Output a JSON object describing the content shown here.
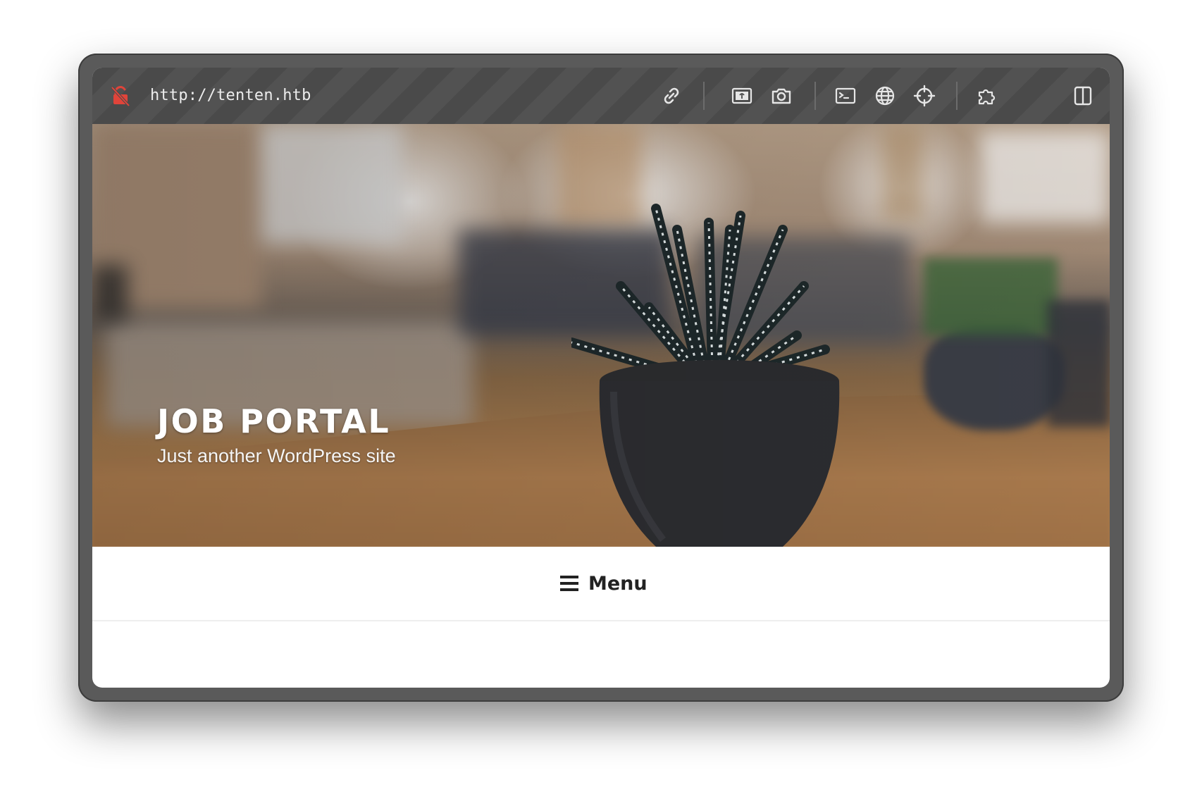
{
  "browser": {
    "url": "http://tenten.htb",
    "icons": {
      "security": "unlock-warning-icon",
      "link": "link-icon",
      "picture": "image-icon",
      "camera": "camera-icon",
      "terminal": "terminal-icon",
      "globe": "globe-icon",
      "target": "crosshair-icon",
      "extensions": "puzzle-icon",
      "split": "split-view-icon"
    },
    "colors": {
      "toolbar": "#4a4a4a",
      "security_icon": "#e0443a"
    }
  },
  "site": {
    "title": "JOB PORTAL",
    "tagline": "Just another WordPress site",
    "menu_label": "Menu"
  }
}
